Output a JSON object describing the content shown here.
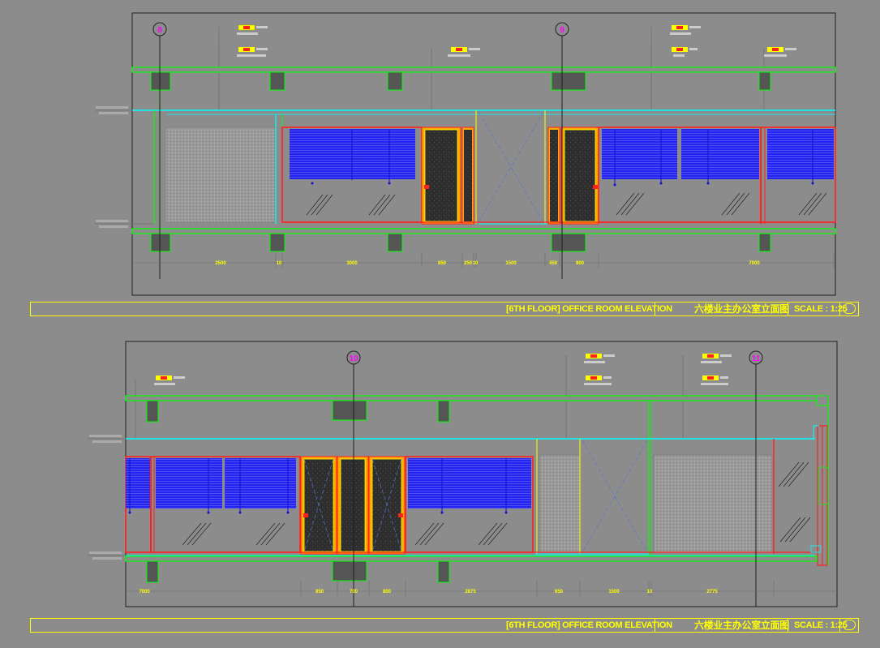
{
  "elevations": [
    {
      "grid_markers": [
        "8",
        "9"
      ],
      "dimensions": [
        "2500",
        "10",
        "3000",
        "850",
        "250",
        "10",
        "1500",
        "450",
        "800",
        "7000"
      ],
      "title_block": {
        "title_en": "[6TH FLOOR] OFFICE ROOM ELEVATION",
        "title_cn": "六楼业主办公室立面图",
        "scale": "SCALE : 1:25"
      }
    },
    {
      "grid_markers": [
        "10",
        "11"
      ],
      "dimensions": [
        "7000",
        "850",
        "700",
        "800",
        "2875",
        "650",
        "1500",
        "10",
        "2775"
      ],
      "title_block": {
        "title_en": "[6TH FLOOR] OFFICE ROOM ELEVATION",
        "title_cn": "六楼业主办公室立面图",
        "scale": "SCALE : 1:25"
      }
    }
  ],
  "colors": {
    "background": "#8c8c8c",
    "frame": "#202020",
    "slab": "#00ff00",
    "ceiling": "#00ffff",
    "glass_frame": "#ff2020",
    "blind": "#2020ff",
    "title_block": "#ffff00",
    "grid_marker_text": "#ff00ff"
  }
}
